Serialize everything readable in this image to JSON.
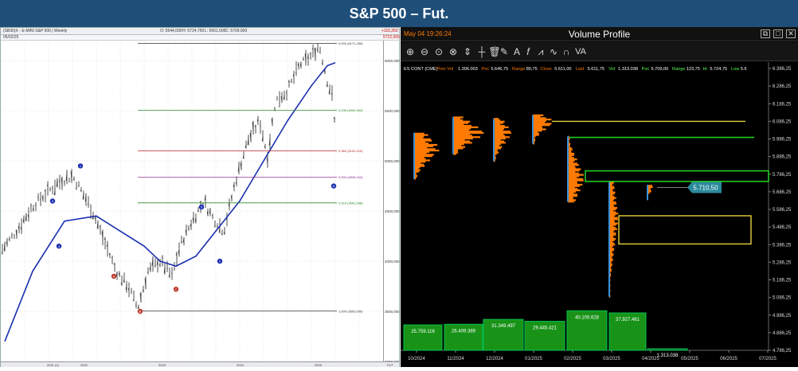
{
  "banner": {
    "title": "S&P 500 – Fut."
  },
  "left_panel": {
    "header_left": "(SB30)X - E-MINI S&P 500 | Weekly",
    "header_ohlc": [
      "O: 5544,000",
      "H: 5724,750",
      "L: 5601,500",
      "C: 5709,000"
    ],
    "header_right": "+115,250",
    "date_label": "05/02/25",
    "price_marker": "5722,000",
    "bottom_dates": [
      "2021 (1)",
      "2022",
      "2023",
      "2024",
      "2025",
      "FUT"
    ]
  },
  "right_panel": {
    "timestamp": "May 04 19:26:24",
    "title": "Volume Profile",
    "toolbar_icons": [
      "zoom-in-icon",
      "zoom-out-icon",
      "zoom-fit-icon",
      "zoom-x-icon",
      "cursor-icon",
      "crosshair-icon",
      "trash-icon",
      "pencil-icon",
      "text-icon",
      "fib-icon",
      "pattern-icon",
      "wave-icon",
      "cycle-icon",
      "va-icon"
    ],
    "toolbar_va_label": "VA",
    "toolbar_text_label": "A",
    "info": {
      "symbol": "ES CONT (CME)",
      "prev_vol_label": "Prev Vol",
      "prev_vol": "1.306.003",
      "poc1_label": "Poc",
      "poc1": "5.646,75",
      "range1_label": "Range",
      "range1": "80,75",
      "close_label": "Close",
      "close": "5.611,00",
      "last_label": "Last",
      "last": "5.611,75",
      "vol_label": "Vol",
      "vol": "1.313.038",
      "poc2_label": "Poc",
      "poc2": "5.709,00",
      "range2_label": "Range",
      "range2": "123,75",
      "hi_label": "Hi",
      "hi": "5.724,75",
      "low_label": "Low",
      "low": "5.6"
    },
    "price_tag": "5.710,50"
  },
  "chart_data": [
    {
      "type": "candlestick",
      "title": "(SB30)X - E-MINI S&P 500 | Weekly",
      "xlabel": "",
      "ylabel": "",
      "x": [
        "2021",
        "2022",
        "2023",
        "2024",
        "2025"
      ],
      "ylim": [
        3000,
        6200
      ],
      "y_ticks": [
        "6000,000",
        "5500,000",
        "5000,000",
        "4500,000",
        "4000,000",
        "3500,000",
        "3000,000"
      ],
      "moving_average": "blue",
      "fibonacci_levels": [
        {
          "label": "0,000 (6171,250)",
          "color": "#333333"
        },
        {
          "label": "0,236 (5503,963)",
          "color": "#2e8b2e"
        },
        {
          "label": "0,382 (5101,019)",
          "color": "#b22222"
        },
        {
          "label": "0,500 (4836,444)",
          "color": "#8b2e8b"
        },
        {
          "label": "0,618 (4581,668)",
          "color": "#2e8b2e"
        },
        {
          "label": "1,000 (3502,000)",
          "color": "#333333"
        }
      ],
      "wave_labels_blue": [
        "1",
        "3",
        "4",
        "5",
        "2",
        "2",
        "A"
      ],
      "wave_labels_red": [
        "A",
        "B",
        "C"
      ]
    },
    {
      "type": "bar",
      "title": "Volume Profile",
      "categories": [
        "10/2024",
        "11/2024",
        "12/2024",
        "01/2025",
        "02/2025",
        "03/2025",
        "04/2025",
        "05/2025",
        "06/2025",
        "07/2025"
      ],
      "values": [
        25759116,
        26409389,
        31349497,
        29445421,
        40105628,
        37927461,
        1313038
      ],
      "value_labels": [
        "25.759.116",
        "26.409.389",
        "31.349.497",
        "29.445.421",
        "40.105.628",
        "37.927.461",
        "1.313.038"
      ],
      "y_ticks": [
        "6.386,25",
        "6.286,25",
        "6.186,25",
        "6.086,25",
        "5.986,25",
        "5.886,25",
        "5.786,25",
        "5.686,25",
        "5.586,25",
        "5.486,25",
        "5.386,25",
        "5.286,25",
        "5.186,25",
        "5.086,25",
        "4.986,25",
        "4.886,25",
        "4.786,25"
      ],
      "ylim": [
        4786.25,
        6386.25
      ],
      "colors": {
        "bars": "#1a9b1a",
        "profile": "#ff7a00",
        "poc_line": "#e6d23a",
        "level_line": "#22cc22"
      }
    }
  ]
}
